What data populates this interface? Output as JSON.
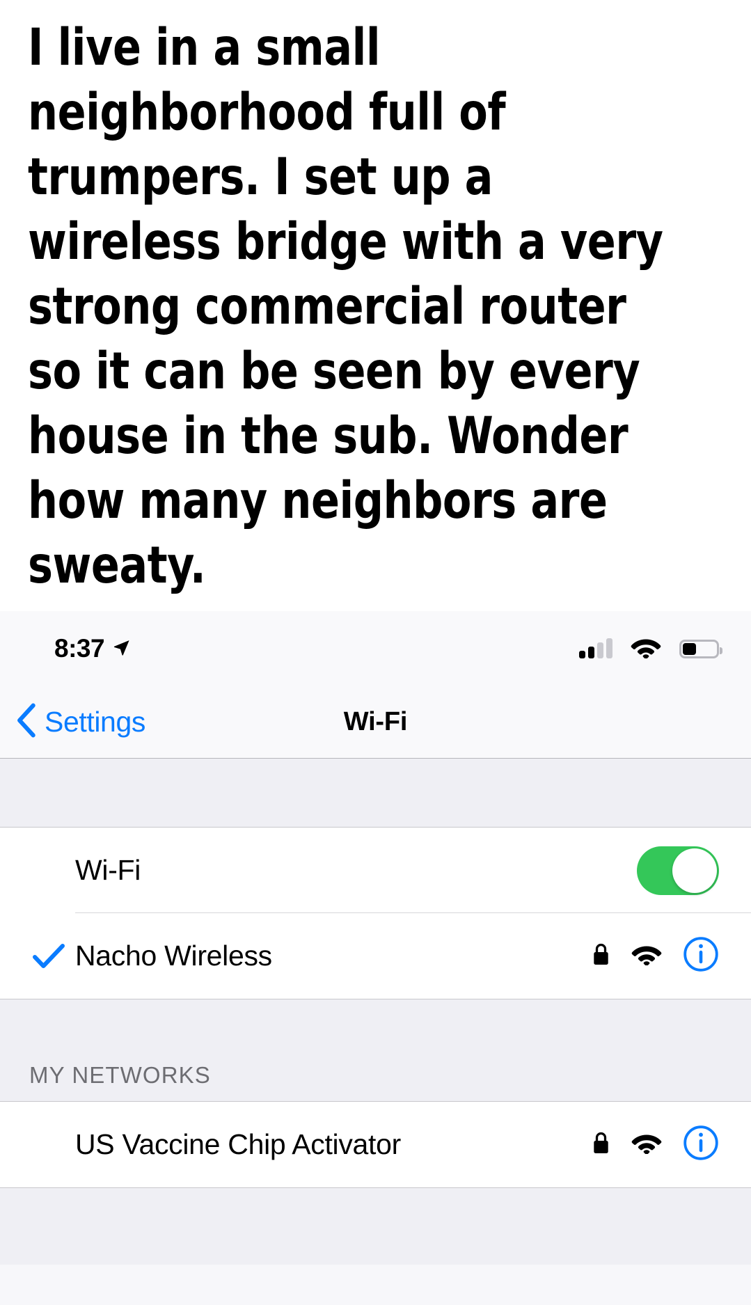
{
  "meme": {
    "caption": "I live in a small neighborhood full of trumpers. I set up a wireless bridge with a very strong commercial router so it can be seen by every house in the sub. Wonder how many neighbors are sweaty."
  },
  "status_bar": {
    "time": "8:37",
    "location_icon": "location-arrow-icon",
    "cellular_icon": "cellular-signal-icon",
    "cellular_bars_filled": 2,
    "cellular_bars_total": 4,
    "wifi_icon": "wifi-icon",
    "battery_icon": "battery-icon",
    "battery_level_percent": 38
  },
  "nav_bar": {
    "back_icon": "chevron-left-icon",
    "back_label": "Settings",
    "title": "Wi-Fi"
  },
  "sections": [
    {
      "header": "",
      "rows": [
        {
          "type": "toggle",
          "label": "Wi-Fi",
          "toggle_on": true,
          "toggle_color": "#34c759"
        },
        {
          "type": "network",
          "label": "Nacho Wireless",
          "connected": true,
          "check_icon": "checkmark-icon",
          "lock_icon": "lock-icon",
          "signal_icon": "wifi-icon",
          "info_icon": "info-circle-icon"
        }
      ]
    },
    {
      "header": "MY NETWORKS",
      "rows": [
        {
          "type": "network",
          "label": "US Vaccine Chip Activator",
          "connected": false,
          "lock_icon": "lock-icon",
          "signal_icon": "wifi-icon",
          "info_icon": "info-circle-icon"
        }
      ]
    }
  ],
  "colors": {
    "ios_blue": "#0a7cff",
    "ios_green": "#34c759",
    "group_bg": "#efeff4",
    "separator": "#c8c7cc",
    "header_text": "#6d6d72"
  }
}
